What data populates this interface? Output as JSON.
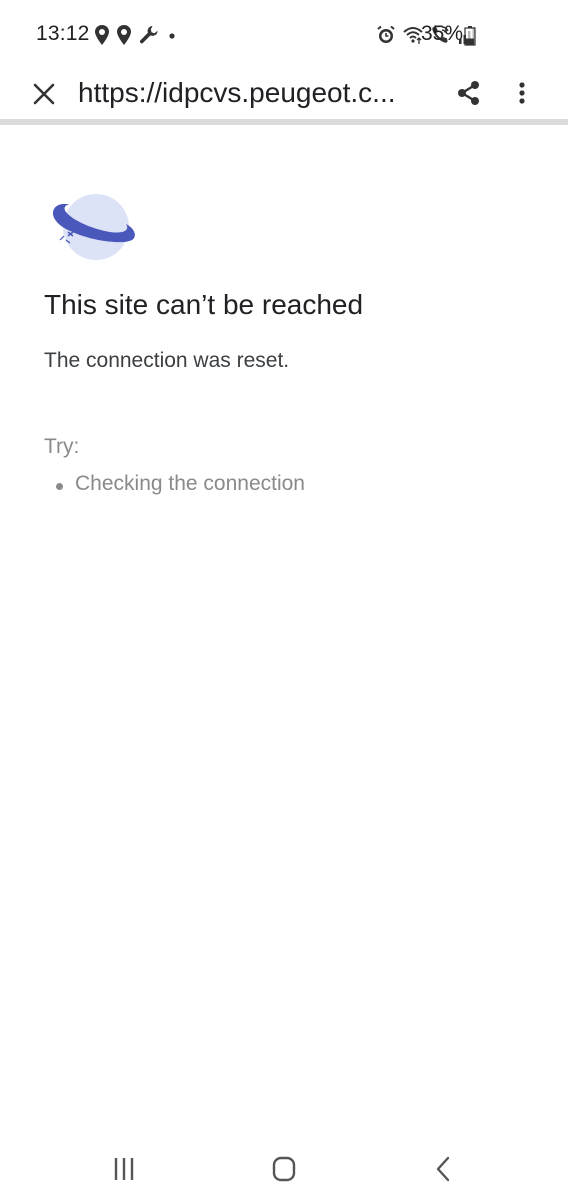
{
  "status_bar": {
    "time": "13:12",
    "battery_percent": "35%",
    "left_icons": [
      "location-icon",
      "location-icon",
      "wrench-icon",
      "dot-icon"
    ],
    "right_icons": [
      "alarm-icon",
      "wifi-icon",
      "wifi-call-icon",
      "signal-icon",
      "battery-icon"
    ],
    "battery_level": 0.35
  },
  "toolbar": {
    "url": "https://idpcvs.peugeot.c...",
    "icons": [
      "close-icon",
      "share-icon",
      "more-vert-icon"
    ]
  },
  "error": {
    "icon": "planet-icon",
    "title": "This site can’t be reached",
    "message": "The connection was reset.",
    "try_label": "Try:",
    "suggestions": [
      "Checking the connection"
    ]
  },
  "nav_bar": {
    "icons": [
      "recents-icon",
      "home-icon",
      "back-icon"
    ]
  },
  "colors": {
    "planet_fill": "#dde3f6",
    "planet_ring": "#4a58bb",
    "muted_text": "#8a8a8a"
  }
}
